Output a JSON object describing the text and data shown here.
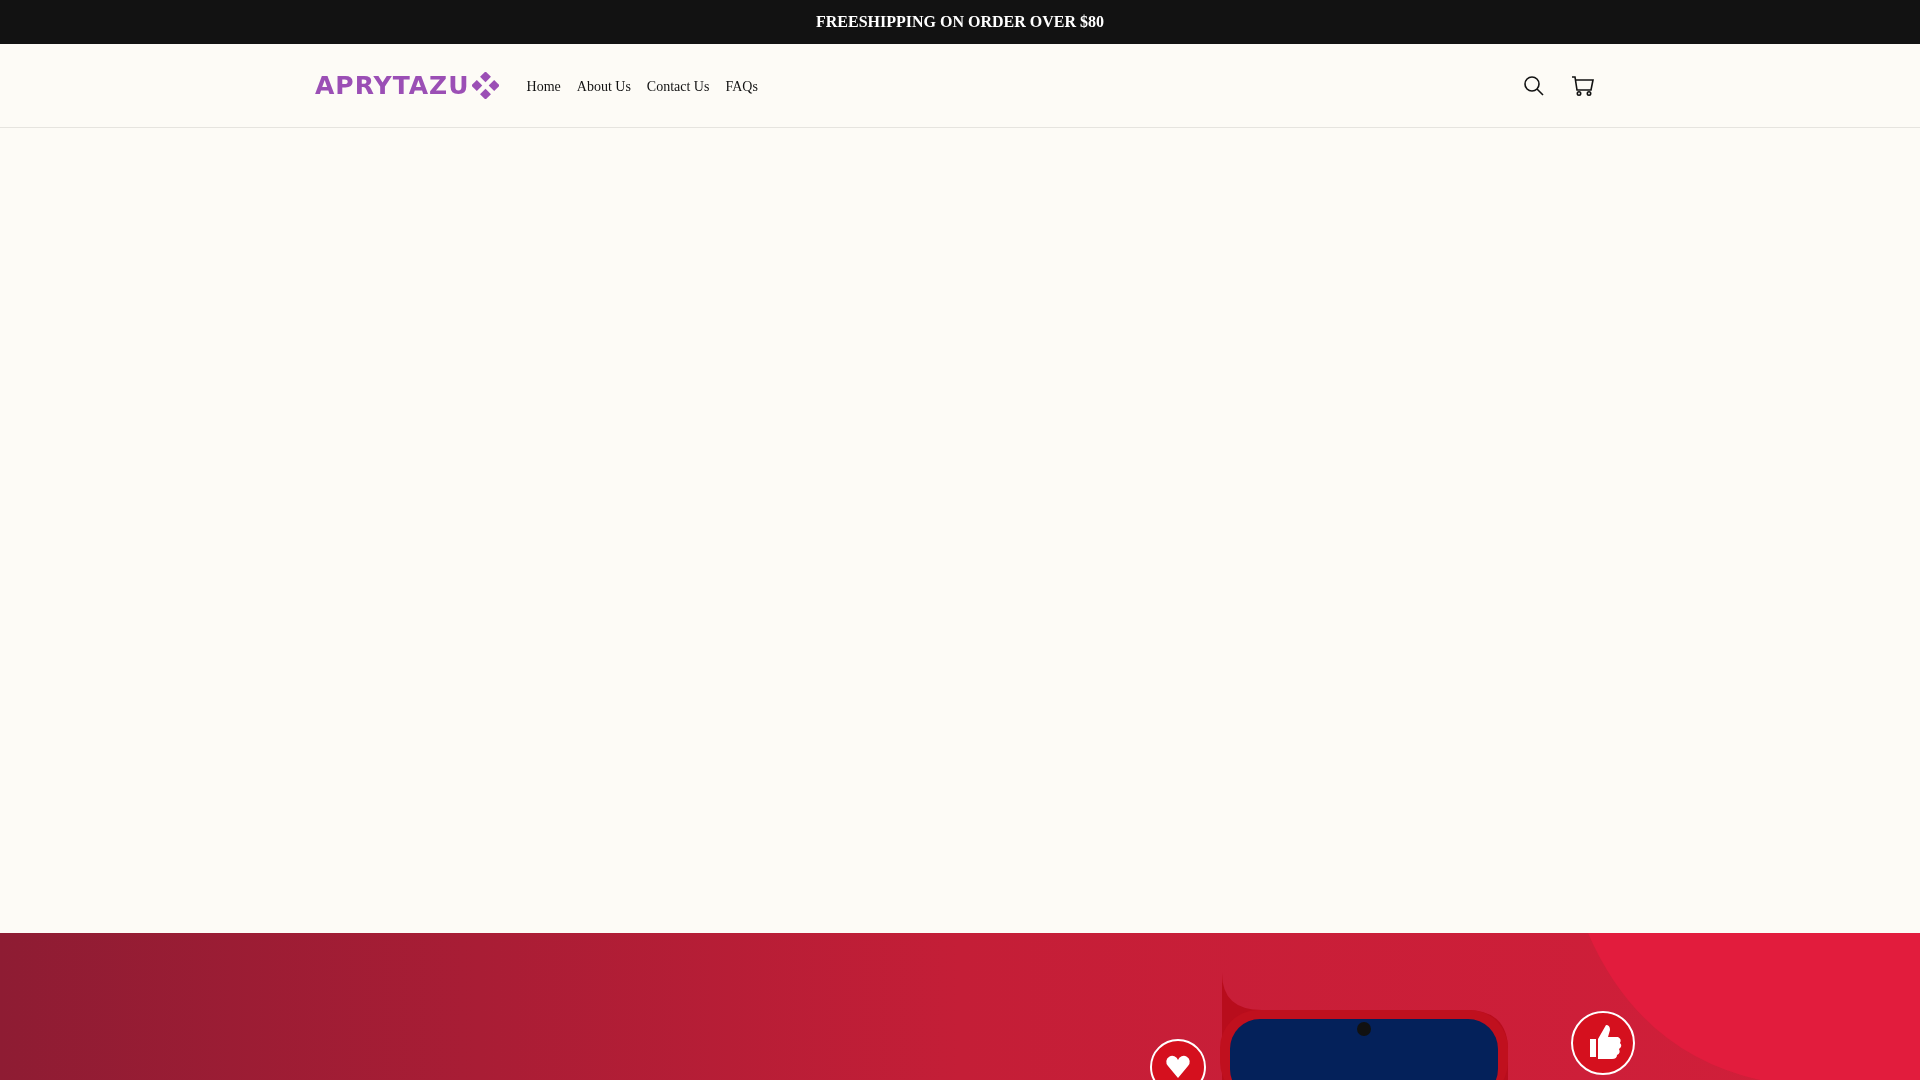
{
  "announcement": "FREESHIPPING ON ORDER OVER $80",
  "header": {
    "logo": "APRYTAZU",
    "nav": [
      {
        "label": "Home"
      },
      {
        "label": "About Us"
      },
      {
        "label": "Contact Us"
      },
      {
        "label": "FAQs"
      }
    ]
  }
}
